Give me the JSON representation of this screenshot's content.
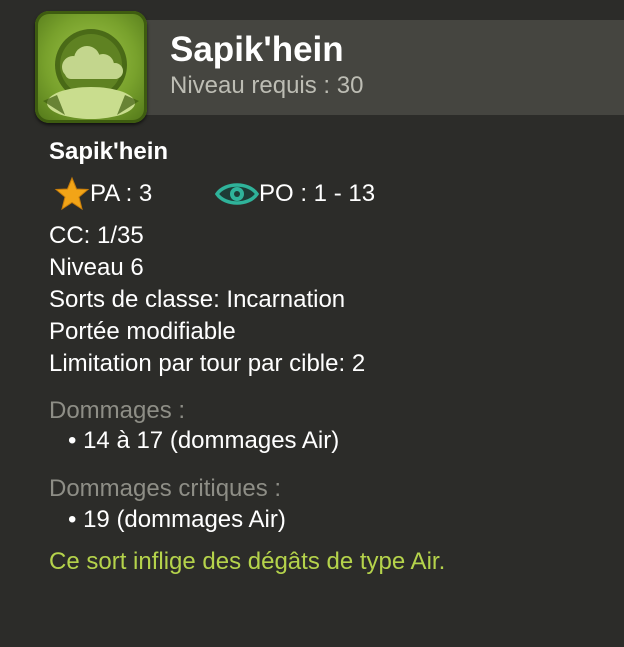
{
  "header": {
    "title": "Sapik'hein",
    "subtitle": "Niveau requis : 30"
  },
  "spell": {
    "name": "Sapik'hein",
    "pa": "PA : 3",
    "po": "PO : 1 - 13",
    "lines": [
      "CC: 1/35",
      "Niveau 6",
      "Sorts de classe: Incarnation",
      "Portée modifiable",
      "Limitation par tour par cible: 2"
    ],
    "damage_title": "Dommages :",
    "damage_value": "14 à 17 (dommages Air)",
    "crit_title": "Dommages critiques :",
    "crit_value": "19 (dommages Air)",
    "note": "Ce sort inflige des dégâts de type Air."
  },
  "icons": {
    "pa": "star-icon",
    "po": "eye-icon",
    "spell": "cloud-spell-icon"
  },
  "colors": {
    "background": "#2c2c29",
    "header_bar": "#454540",
    "muted_text": "#8e8e86",
    "note_text": "#b5d34b",
    "star": "#f2a417",
    "eye": "#2fb39a"
  }
}
